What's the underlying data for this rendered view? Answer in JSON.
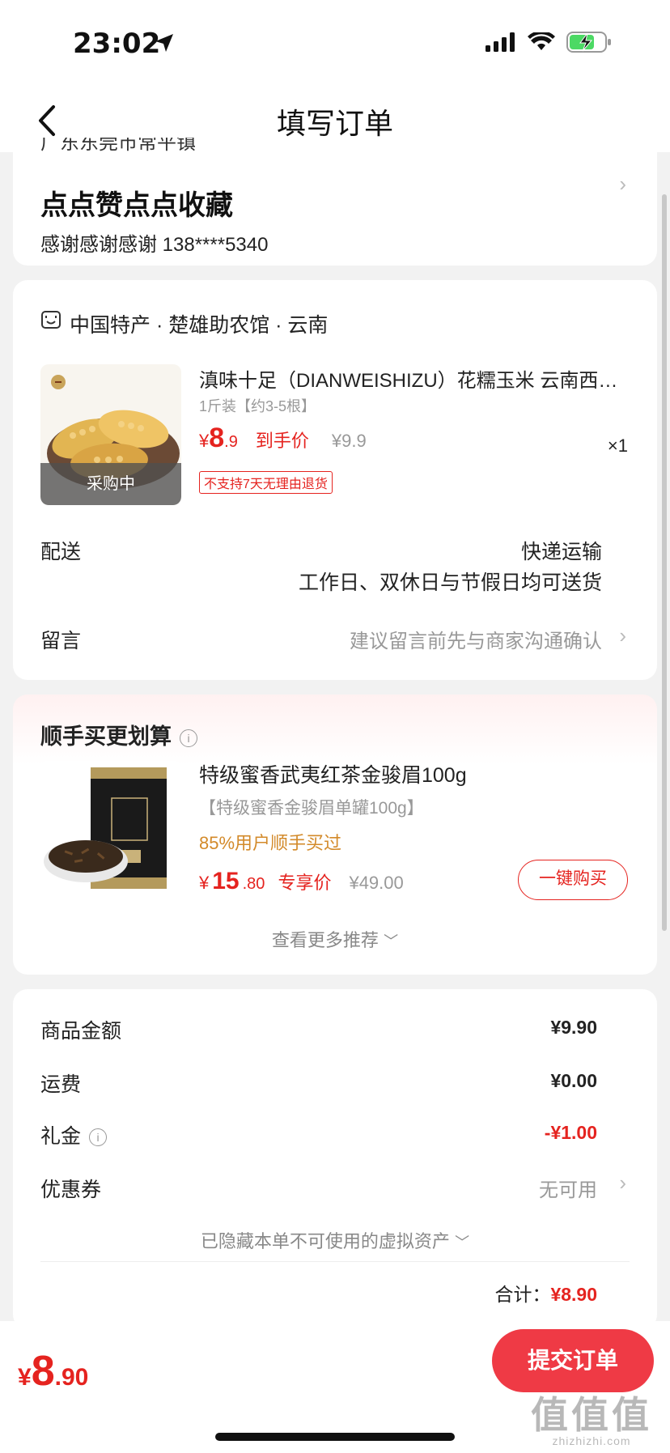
{
  "status": {
    "time": "23:02"
  },
  "nav": {
    "title": "填写订单"
  },
  "address": {
    "cut_line": "广东东莞市常平镇",
    "name": "点点赞点点收藏",
    "contact": "感谢感谢感谢  138****5340"
  },
  "shop": {
    "name": "中国特产 · 楚雄助农馆 · 云南",
    "product": {
      "title": "滇味十足（DIANWEISHIZU）花糯玉米 云南西…",
      "spec": "1斤装【约3-5根】",
      "price_cur": "¥",
      "price_int": "8",
      "price_dec": ".9",
      "price_tag": "到手价",
      "orig_price": "¥9.9",
      "qty": "×1",
      "badge": "采购中",
      "no_return": "不支持7天无理由退货"
    },
    "delivery_label": "配送",
    "delivery_value": "快递运输",
    "delivery_note": "工作日、双休日与节假日均可送货",
    "message_label": "留言",
    "message_hint": "建议留言前先与商家沟通确认"
  },
  "recommend": {
    "title": "顺手买更划算",
    "item": {
      "title": "特级蜜香武夷红茶金骏眉100g",
      "spec": "【特级蜜香金骏眉单罐100g】",
      "social": "85%用户顺手买过",
      "price_cur": "¥",
      "price_int": "15",
      "price_dec": ".80",
      "price_tag": "专享价",
      "orig_price": "¥49.00",
      "buy_label": "一键购买"
    },
    "more_label": "查看更多推荐"
  },
  "summary": {
    "rows": [
      {
        "label": "商品金额",
        "value": "¥9.90"
      },
      {
        "label": "运费",
        "value": "¥0.00"
      },
      {
        "label": "礼金",
        "value": "-¥1.00"
      },
      {
        "label": "优惠券",
        "value": "无可用"
      }
    ],
    "hidden_assets": "已隐藏本单不可使用的虚拟资产",
    "total_label": "合计：",
    "total_value": "¥8.90"
  },
  "bottom": {
    "price_cur": "¥",
    "price_int": "8",
    "price_dec": ".90",
    "submit_label": "提交订单"
  },
  "watermark": {
    "logo": "值值值",
    "url": "zhizhizhi.com"
  },
  "colors": {
    "accent": "#e5231f",
    "submit": "#ef3a45",
    "social": "#d38a2a"
  }
}
